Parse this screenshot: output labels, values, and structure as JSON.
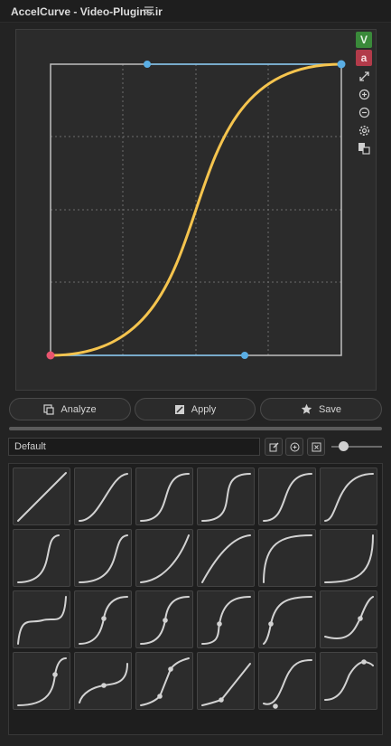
{
  "window": {
    "title": "AccelCurve - Video-Plugins.ir",
    "menu_icon": "hamburger-icon"
  },
  "editor": {
    "colors": {
      "curve": "#f5c44e",
      "handle_line": "#79bce6",
      "start_point": "#e8556f",
      "end_point": "#5aaee4"
    },
    "side_tools": [
      {
        "name": "value-mode-toggle",
        "label": "V",
        "color": "#3a8a3a"
      },
      {
        "name": "accel-mode-toggle",
        "label": "a",
        "color": "#b23b4a"
      },
      {
        "name": "fit-view-icon"
      },
      {
        "name": "zoom-in-icon"
      },
      {
        "name": "zoom-out-icon"
      },
      {
        "name": "settings-gear-icon"
      },
      {
        "name": "copy-paste-icon"
      }
    ]
  },
  "actions": {
    "analyze_label": "Analyze",
    "apply_label": "Apply",
    "save_label": "Save"
  },
  "presets": {
    "selected": "Default",
    "thumb_zoom_fraction": 0.2,
    "items": [
      {
        "name": "linear"
      },
      {
        "name": "ease-in-out-soft"
      },
      {
        "name": "ease-in-out"
      },
      {
        "name": "ease-in-out-strong"
      },
      {
        "name": "ease-out-fast"
      },
      {
        "name": "ease-out-smooth"
      },
      {
        "name": "ease-in-out-late"
      },
      {
        "name": "ease-in-late"
      },
      {
        "name": "ease-in-quad"
      },
      {
        "name": "ease-out-quad"
      },
      {
        "name": "ease-out-expo"
      },
      {
        "name": "ease-in-expo"
      },
      {
        "name": "hold-middle"
      },
      {
        "name": "stepped-point"
      },
      {
        "name": "stepped-mid"
      },
      {
        "name": "stepped-low"
      },
      {
        "name": "ease-out-point"
      },
      {
        "name": "s-point-high"
      },
      {
        "name": "ease-in-point"
      },
      {
        "name": "plateau-point"
      },
      {
        "name": "two-point-linear"
      },
      {
        "name": "two-point-ramp"
      },
      {
        "name": "undershoot"
      },
      {
        "name": "overshoot"
      }
    ]
  }
}
